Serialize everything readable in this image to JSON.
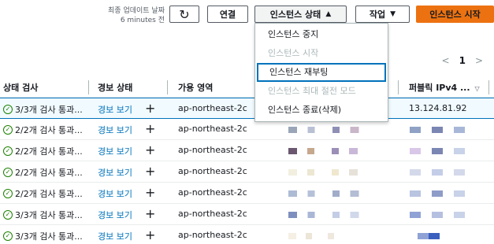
{
  "toolbar": {
    "last_updated_line1": "최종 업데이트 날짜",
    "last_updated_line2": "6 minutes 전",
    "refresh_glyph": "↻",
    "connect_label": "연결",
    "instance_state_label": "인스턴스 상태",
    "instance_state_caret": "▲",
    "actions_label": "작업",
    "actions_caret": "▼",
    "start_label": "인스턴스 시작"
  },
  "menu": {
    "items": [
      {
        "label": "인스턴스 중지",
        "disabled": false
      },
      {
        "label": "인스턴스 시작",
        "disabled": true
      },
      {
        "label": "인스턴스 재부팅",
        "disabled": false,
        "focused": true
      },
      {
        "label": "인스턴스 최대 절전 모드",
        "disabled": true
      },
      {
        "label": "인스턴스 종료(삭제)",
        "disabled": false
      }
    ]
  },
  "pager": {
    "prev": "<",
    "page": "1",
    "next": ">"
  },
  "table": {
    "headers": {
      "status_check": "상태 검사",
      "alarm_status": "경보 상태",
      "availability_zone": "가용 영역",
      "public_ipv4": "퍼블릭 IPv4 ...",
      "public_ipv4_sort": "▽"
    },
    "rows": [
      {
        "status": "3/3개 검사 통과...",
        "alarm": "경보 보기",
        "az": "ap-northeast-2c",
        "ip": "13.124.81.92"
      },
      {
        "status": "2/2개 검사 통과...",
        "alarm": "경보 보기",
        "az": "ap-northeast-2c",
        "ip": ""
      },
      {
        "status": "2/2개 검사 통과...",
        "alarm": "경보 보기",
        "az": "ap-northeast-2c",
        "ip": ""
      },
      {
        "status": "2/2개 검사 통과...",
        "alarm": "경보 보기",
        "az": "ap-northeast-2c",
        "ip": ""
      },
      {
        "status": "2/2개 검사 통과...",
        "alarm": "경보 보기",
        "az": "ap-northeast-2c",
        "ip": ""
      },
      {
        "status": "3/3개 검사 통과...",
        "alarm": "경보 보기",
        "az": "ap-northeast-2c",
        "ip": ""
      },
      {
        "status": "3/3개 검사 통과...",
        "alarm": "경보 보기",
        "az": "ap-northeast-2c",
        "ip": ""
      }
    ],
    "check_glyph": "✓",
    "plus_glyph": "+"
  },
  "colors": {
    "accent": "#ec7211",
    "link": "#0073bb",
    "success": "#1d8102",
    "selected_bg": "#f1faff"
  }
}
